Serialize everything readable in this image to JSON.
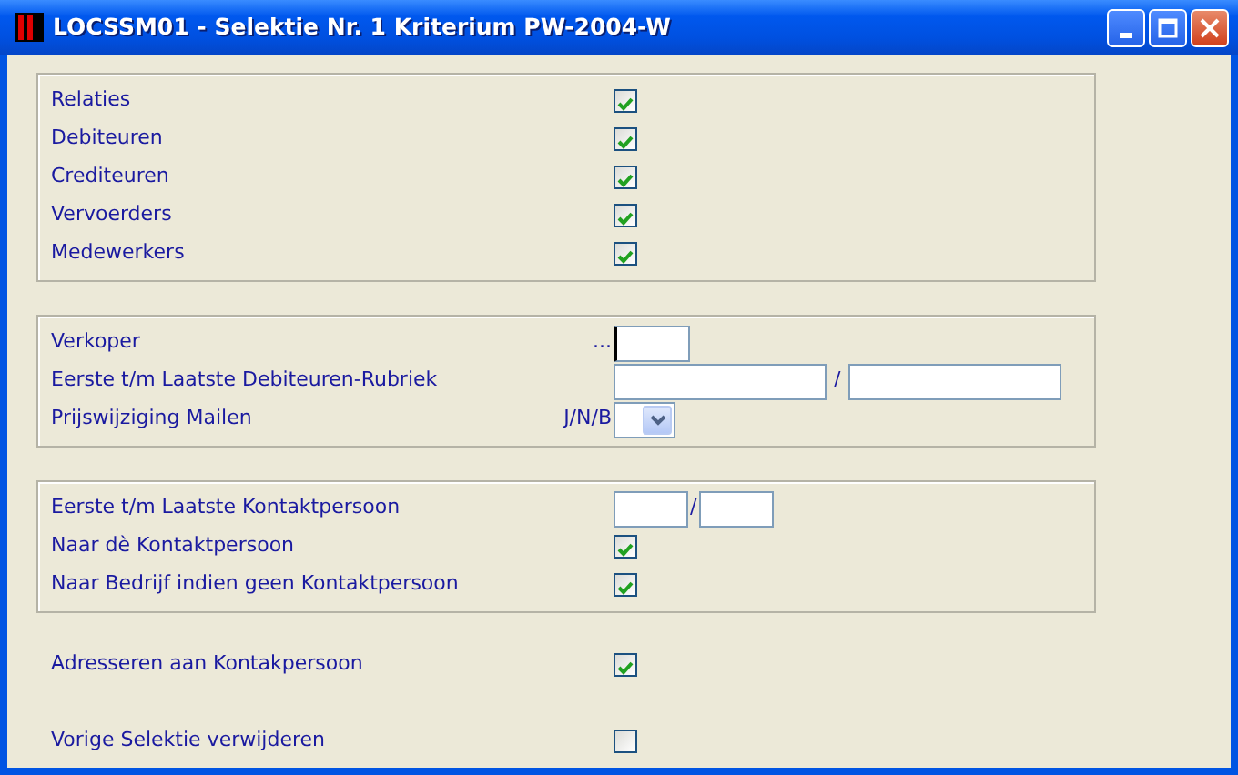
{
  "window": {
    "title": "LOCSSM01 - Selektie Nr. 1 Kriterium PW-2004-W"
  },
  "groups": [
    {
      "rows": [
        {
          "kind": "checkbox",
          "label": "Relaties",
          "checked": true
        },
        {
          "kind": "checkbox",
          "label": "Debiteuren",
          "checked": true
        },
        {
          "kind": "checkbox",
          "label": "Crediteuren",
          "checked": true
        },
        {
          "kind": "checkbox",
          "label": "Vervoerders",
          "checked": true
        },
        {
          "kind": "checkbox",
          "label": "Medewerkers",
          "checked": true
        }
      ]
    },
    {
      "rows": [
        {
          "kind": "input",
          "label": "Verkoper",
          "hint": "...",
          "focused": true
        },
        {
          "kind": "long-range",
          "label": "Eerste t/m Laatste Debiteuren-Rubriek",
          "separator": "/"
        },
        {
          "kind": "select",
          "label": "Prijswijziging Mailen",
          "hint": "J/N/B"
        }
      ]
    },
    {
      "rows": [
        {
          "kind": "short-range",
          "label": "Eerste t/m Laatste Kontaktpersoon",
          "separator": "/"
        },
        {
          "kind": "checkbox",
          "label": "Naar dè Kontaktpersoon",
          "checked": true
        },
        {
          "kind": "checkbox",
          "label": "Naar Bedrijf indien geen Kontaktpersoon",
          "checked": true
        }
      ]
    }
  ],
  "loose_rows": [
    {
      "kind": "checkbox",
      "label": "Adresseren aan Kontakpersoon",
      "checked": true
    },
    {
      "kind": "checkbox",
      "label": "Vorige Selektie verwijderen",
      "checked": false
    }
  ]
}
